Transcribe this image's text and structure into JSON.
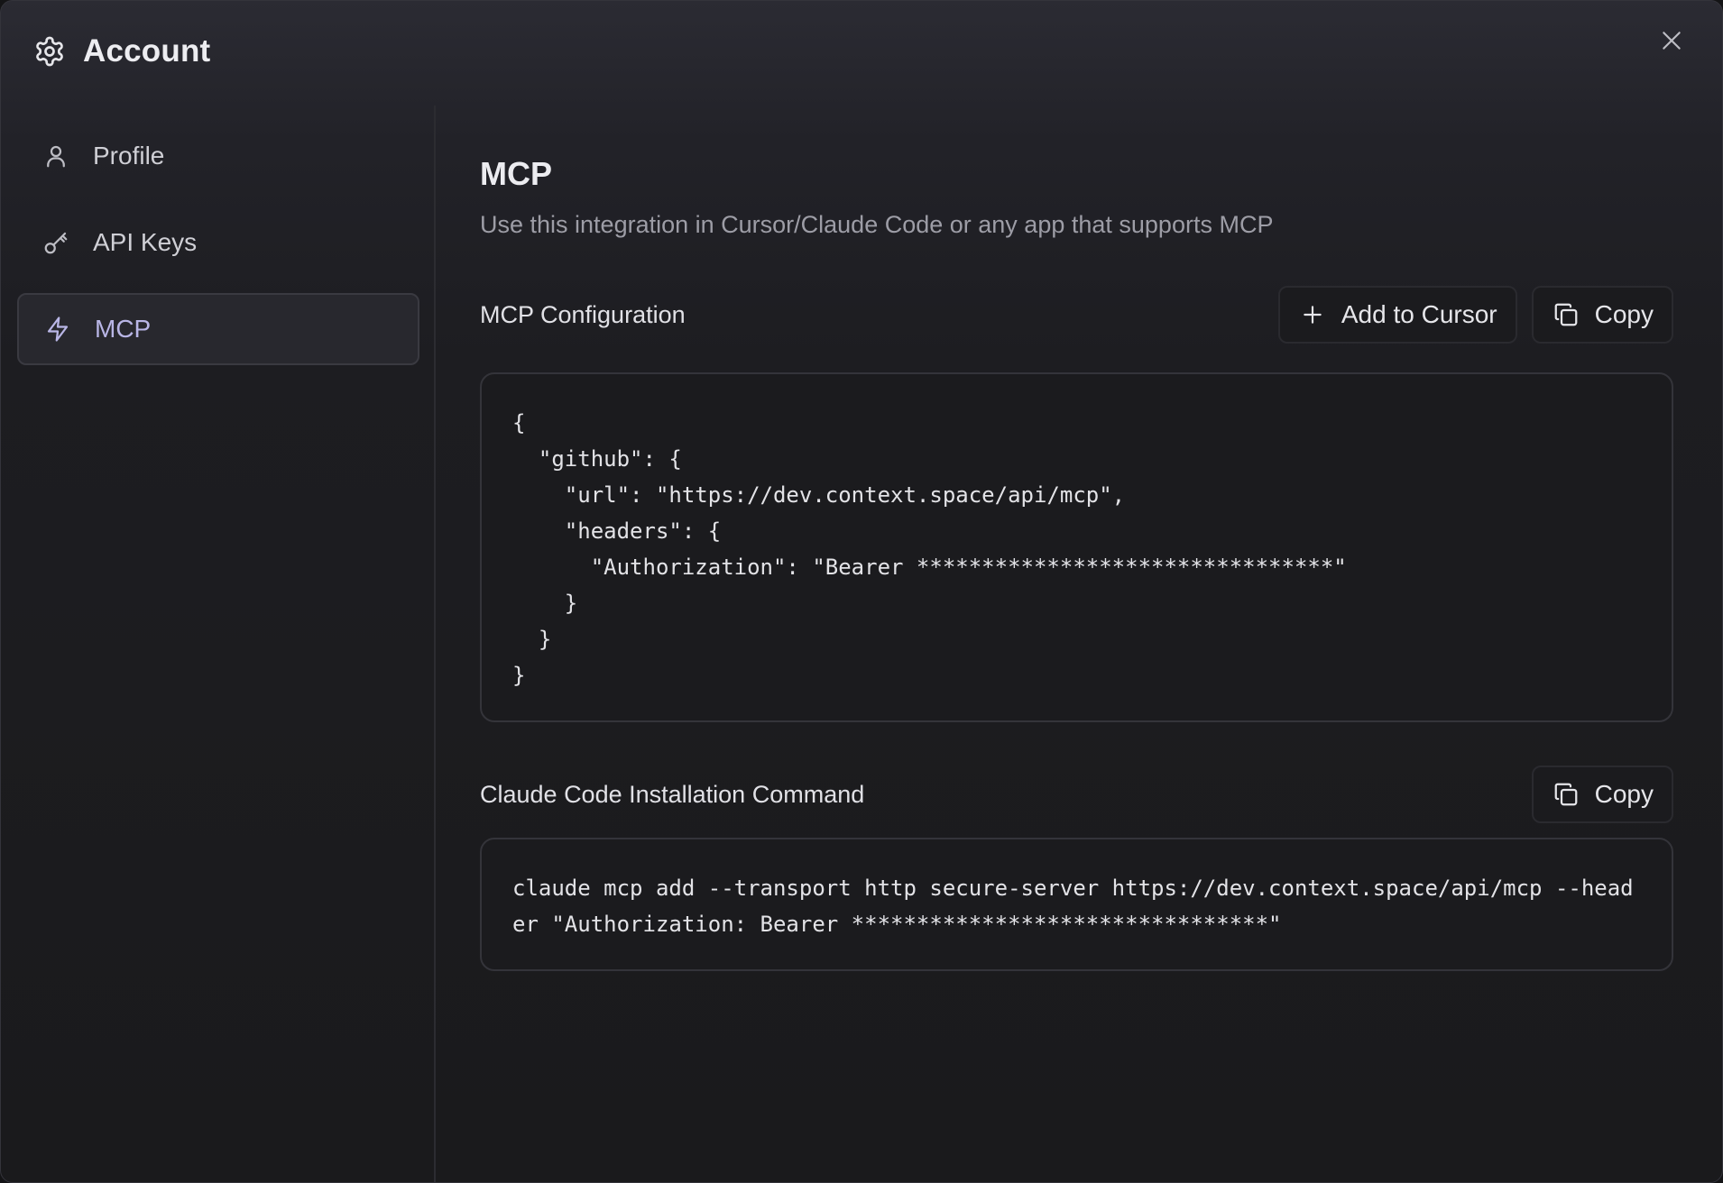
{
  "header": {
    "title": "Account",
    "icon": "gear-icon"
  },
  "sidebar": {
    "items": [
      {
        "label": "Profile",
        "icon": "user-icon",
        "active": false
      },
      {
        "label": "API Keys",
        "icon": "key-icon",
        "active": false
      },
      {
        "label": "MCP",
        "icon": "bolt-icon",
        "active": true
      }
    ]
  },
  "main": {
    "title": "MCP",
    "subtitle": "Use this integration in Cursor/Claude Code or any app that supports MCP",
    "config": {
      "title": "MCP Configuration",
      "add_button": "Add to Cursor",
      "copy_button": "Copy",
      "code_lines": [
        "{",
        "  \"github\": {",
        "    \"url\": \"https://dev.context.space/api/mcp\",",
        "    \"headers\": {",
        "      \"Authorization\": \"Bearer ********************************\"",
        "    }",
        "  }",
        "}"
      ]
    },
    "install": {
      "title": "Claude Code Installation Command",
      "copy_button": "Copy",
      "command": "claude mcp add --transport http secure-server https://dev.context.space/api/mcp --header \"Authorization: Bearer ********************************\""
    }
  },
  "colors": {
    "accent": "#b9b6e6",
    "background": "#1a1a1c",
    "border": "#34343a"
  }
}
